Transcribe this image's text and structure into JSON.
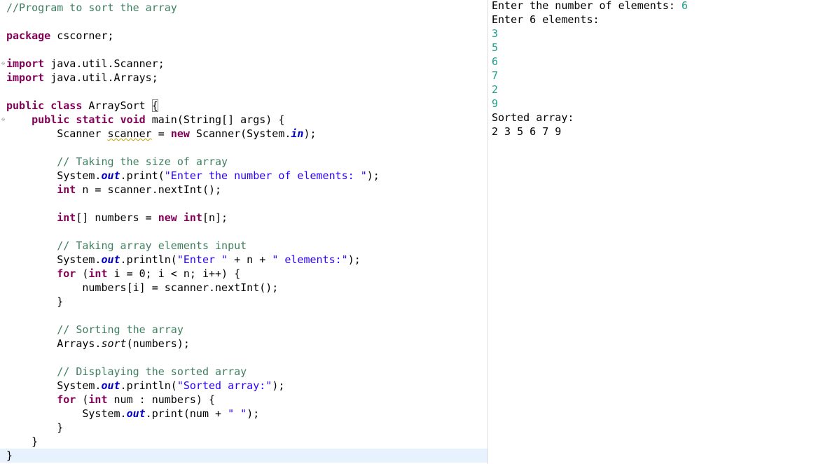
{
  "editor": {
    "lines": [
      {
        "tokens": [
          {
            "t": "//Program to sort the array",
            "c": "cm"
          }
        ]
      },
      {
        "tokens": []
      },
      {
        "tokens": [
          {
            "t": "package",
            "c": "kw"
          },
          {
            "t": " cscorner;"
          }
        ]
      },
      {
        "tokens": []
      },
      {
        "fold": true,
        "tokens": [
          {
            "t": "import",
            "c": "kw"
          },
          {
            "t": " java.util.Scanner;"
          }
        ]
      },
      {
        "tokens": [
          {
            "t": "import",
            "c": "kw"
          },
          {
            "t": " java.util.Arrays;"
          }
        ]
      },
      {
        "tokens": []
      },
      {
        "tokens": [
          {
            "t": "public",
            "c": "kw"
          },
          {
            "t": " "
          },
          {
            "t": "class",
            "c": "kw"
          },
          {
            "t": " ArraySort "
          },
          {
            "t": "{",
            "c": "bracket"
          }
        ]
      },
      {
        "fold": true,
        "tokens": [
          {
            "t": "    "
          },
          {
            "t": "public",
            "c": "kw"
          },
          {
            "t": " "
          },
          {
            "t": "static",
            "c": "kw"
          },
          {
            "t": " "
          },
          {
            "t": "void",
            "c": "kw"
          },
          {
            "t": " main(String[] args) {"
          }
        ]
      },
      {
        "tokens": [
          {
            "t": "        Scanner "
          },
          {
            "t": "scanner",
            "c": "warn"
          },
          {
            "t": " = "
          },
          {
            "t": "new",
            "c": "kw"
          },
          {
            "t": " Scanner(System."
          },
          {
            "t": "in",
            "c": "fld"
          },
          {
            "t": ");"
          }
        ]
      },
      {
        "tokens": []
      },
      {
        "tokens": [
          {
            "t": "        "
          },
          {
            "t": "// Taking the size of array",
            "c": "cm"
          }
        ]
      },
      {
        "tokens": [
          {
            "t": "        System."
          },
          {
            "t": "out",
            "c": "fld"
          },
          {
            "t": ".print("
          },
          {
            "t": "\"Enter the number of elements: \"",
            "c": "str"
          },
          {
            "t": ");"
          }
        ]
      },
      {
        "tokens": [
          {
            "t": "        "
          },
          {
            "t": "int",
            "c": "kw"
          },
          {
            "t": " n = scanner.nextInt();"
          }
        ]
      },
      {
        "tokens": []
      },
      {
        "tokens": [
          {
            "t": "        "
          },
          {
            "t": "int",
            "c": "kw"
          },
          {
            "t": "[] numbers = "
          },
          {
            "t": "new",
            "c": "kw"
          },
          {
            "t": " "
          },
          {
            "t": "int",
            "c": "kw"
          },
          {
            "t": "[n];"
          }
        ]
      },
      {
        "tokens": []
      },
      {
        "tokens": [
          {
            "t": "        "
          },
          {
            "t": "// Taking array elements input",
            "c": "cm"
          }
        ]
      },
      {
        "tokens": [
          {
            "t": "        System."
          },
          {
            "t": "out",
            "c": "fld"
          },
          {
            "t": ".println("
          },
          {
            "t": "\"Enter \"",
            "c": "str"
          },
          {
            "t": " + n + "
          },
          {
            "t": "\" elements:\"",
            "c": "str"
          },
          {
            "t": ");"
          }
        ]
      },
      {
        "tokens": [
          {
            "t": "        "
          },
          {
            "t": "for",
            "c": "kw"
          },
          {
            "t": " ("
          },
          {
            "t": "int",
            "c": "kw"
          },
          {
            "t": " i = 0; i < n; i++) {"
          }
        ]
      },
      {
        "tokens": [
          {
            "t": "            numbers[i] = scanner.nextInt();"
          }
        ]
      },
      {
        "tokens": [
          {
            "t": "        }"
          }
        ]
      },
      {
        "tokens": []
      },
      {
        "tokens": [
          {
            "t": "        "
          },
          {
            "t": "// Sorting the array",
            "c": "cm"
          }
        ]
      },
      {
        "tokens": [
          {
            "t": "        Arrays."
          },
          {
            "t": "sort",
            "c": "ital"
          },
          {
            "t": "(numbers);"
          }
        ]
      },
      {
        "tokens": []
      },
      {
        "tokens": [
          {
            "t": "        "
          },
          {
            "t": "// Displaying the sorted array",
            "c": "cm"
          }
        ]
      },
      {
        "tokens": [
          {
            "t": "        System."
          },
          {
            "t": "out",
            "c": "fld"
          },
          {
            "t": ".println("
          },
          {
            "t": "\"Sorted array:\"",
            "c": "str"
          },
          {
            "t": ");"
          }
        ]
      },
      {
        "tokens": [
          {
            "t": "        "
          },
          {
            "t": "for",
            "c": "kw"
          },
          {
            "t": " ("
          },
          {
            "t": "int",
            "c": "kw"
          },
          {
            "t": " num : numbers) {"
          }
        ]
      },
      {
        "tokens": [
          {
            "t": "            System."
          },
          {
            "t": "out",
            "c": "fld"
          },
          {
            "t": ".print(num + "
          },
          {
            "t": "\" \"",
            "c": "str"
          },
          {
            "t": ");"
          }
        ]
      },
      {
        "tokens": [
          {
            "t": "        }"
          }
        ]
      },
      {
        "tokens": [
          {
            "t": "    }"
          }
        ]
      },
      {
        "current": true,
        "tokens": [
          {
            "t": "}"
          }
        ]
      }
    ]
  },
  "console": {
    "lines": [
      {
        "parts": [
          {
            "t": "Enter the number of elements: ",
            "k": "out"
          },
          {
            "t": "6",
            "k": "in"
          }
        ]
      },
      {
        "parts": [
          {
            "t": "Enter 6 elements:",
            "k": "out"
          }
        ]
      },
      {
        "parts": [
          {
            "t": "3",
            "k": "in"
          }
        ]
      },
      {
        "parts": [
          {
            "t": "5",
            "k": "in"
          }
        ]
      },
      {
        "parts": [
          {
            "t": "6",
            "k": "in"
          }
        ]
      },
      {
        "parts": [
          {
            "t": "7",
            "k": "in"
          }
        ]
      },
      {
        "parts": [
          {
            "t": "2",
            "k": "in"
          }
        ]
      },
      {
        "parts": [
          {
            "t": "9",
            "k": "in"
          }
        ]
      },
      {
        "parts": [
          {
            "t": "Sorted array:",
            "k": "out"
          }
        ]
      },
      {
        "parts": [
          {
            "t": "2 3 5 6 7 9 ",
            "k": "out"
          }
        ]
      }
    ]
  },
  "colors": {
    "keyword": "#7f0055",
    "comment": "#3f7f5f",
    "string": "#2a00ff",
    "field": "#0000c0",
    "console_input": "#1fa08a",
    "current_line": "#e8f2fe"
  }
}
